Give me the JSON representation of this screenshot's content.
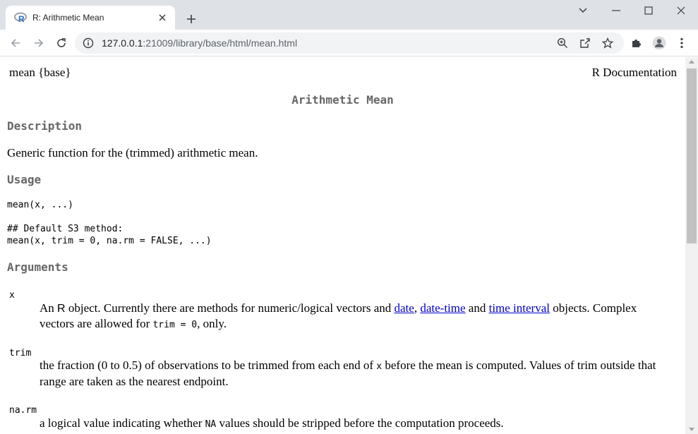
{
  "browser": {
    "tab_title": "R: Arithmetic Mean",
    "url_host": "127.0.0.1",
    "url_path": ":21009/library/base/html/mean.html"
  },
  "page": {
    "header_left": "mean {base}",
    "header_right": "R Documentation",
    "title": "Arithmetic Mean",
    "description": {
      "heading": "Description",
      "text": "Generic function for the (trimmed) arithmetic mean."
    },
    "usage": {
      "heading": "Usage",
      "line1": "mean(x, ...)",
      "line2": "## Default S3 method:",
      "line3": "mean(x, trim = 0, na.rm = FALSE, ...)"
    },
    "arguments": {
      "heading": "Arguments",
      "x": {
        "name": "x",
        "t1": "An ",
        "r": "R",
        "t2": " object. Currently there are methods for numeric/logical vectors and ",
        "link_date": "date",
        "t3": ", ",
        "link_datetime": "date-time",
        "t4": " and ",
        "link_interval": "time interval",
        "t5": " objects. Complex vectors are allowed for ",
        "code": "trim = 0",
        "t6": ", only."
      },
      "trim": {
        "name": "trim",
        "t1": "the fraction (0 to 0.5) of observations to be trimmed from each end of ",
        "code": "x",
        "t2": " before the mean is computed. Values of trim outside that range are taken as the nearest endpoint."
      },
      "narm": {
        "name": "na.rm",
        "t1": "a logical value indicating whether ",
        "code": "NA",
        "t2": " values should be stripped before the computation proceeds."
      }
    }
  }
}
